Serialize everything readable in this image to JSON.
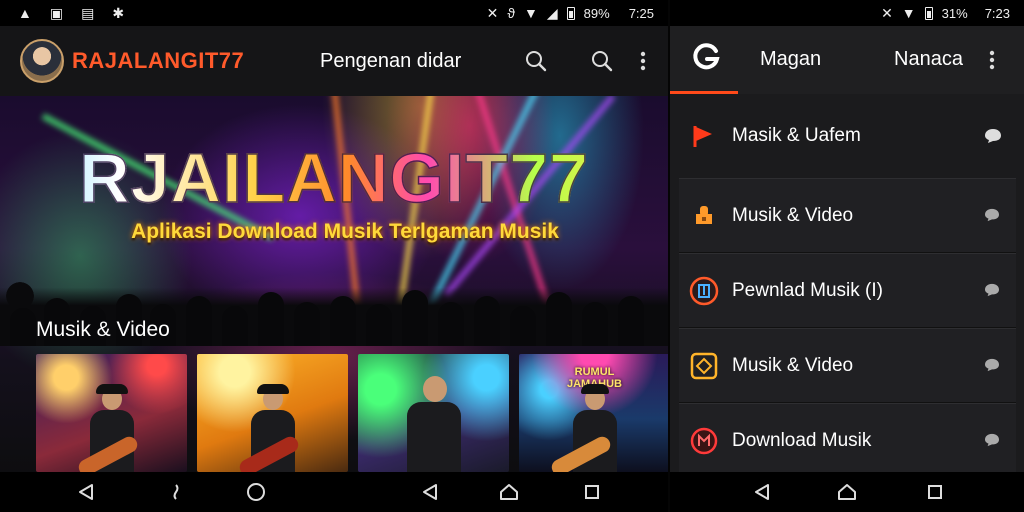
{
  "left": {
    "status_bar": {
      "clock": "7:25",
      "battery": "89%",
      "left_icons": [
        "alert-icon",
        "image-icon",
        "gallery-icon",
        "bluetooth-icon"
      ],
      "right_icons": [
        "mute-icon",
        "nfc-icon",
        "wifi-icon",
        "signal-icon",
        "battery-icon"
      ]
    },
    "app_bar": {
      "brand": "RAJALANGIT77",
      "title": "Pengenan didar",
      "actions": [
        "search-icon",
        "search-icon",
        "more-vert-icon"
      ]
    },
    "hero": {
      "title": "RJAILANGIT77",
      "subtitle": "Aplikasi Download Musik Terlgaman Musik"
    },
    "section": {
      "title": "Musik & Video",
      "thumbnails": [
        {
          "caption": ""
        },
        {
          "caption": ""
        },
        {
          "caption": ""
        },
        {
          "caption": "RUMUL\nJAMAHUB"
        }
      ]
    },
    "nav_bar": [
      "back-icon",
      "recents-icon",
      "home-icon",
      "back-icon",
      "home-icon",
      "overview-icon"
    ]
  },
  "right": {
    "status_bar": {
      "clock": "7:23",
      "battery": "31%",
      "icons": [
        "mute-icon",
        "wifi-icon",
        "battery-icon"
      ]
    },
    "app_bar": {
      "tabs": [
        "Magan",
        "Nanaca"
      ],
      "actions": [
        "more-vert-icon"
      ]
    },
    "menu": [
      {
        "label": "Masik & Uafem",
        "icon": "flag-icon",
        "color": "#ff3a1a"
      },
      {
        "label": "Musik & Video",
        "icon": "audio-icon",
        "color": "#ff9a2a"
      },
      {
        "label": "Pewnlad Musik (I)",
        "icon": "download-icon",
        "color": "#ff5a2a"
      },
      {
        "label": "Musik & Video",
        "icon": "music-box-icon",
        "color": "#ffb42a"
      },
      {
        "label": "Download Musik",
        "icon": "music-circle-icon",
        "color": "#ff3a3a"
      }
    ],
    "nav_bar": [
      "back-icon",
      "home-icon",
      "overview-icon"
    ]
  },
  "colors": {
    "accent": "#ff5a2b",
    "indicator": "#ff4a1a",
    "subtitle": "#ffd93a"
  }
}
